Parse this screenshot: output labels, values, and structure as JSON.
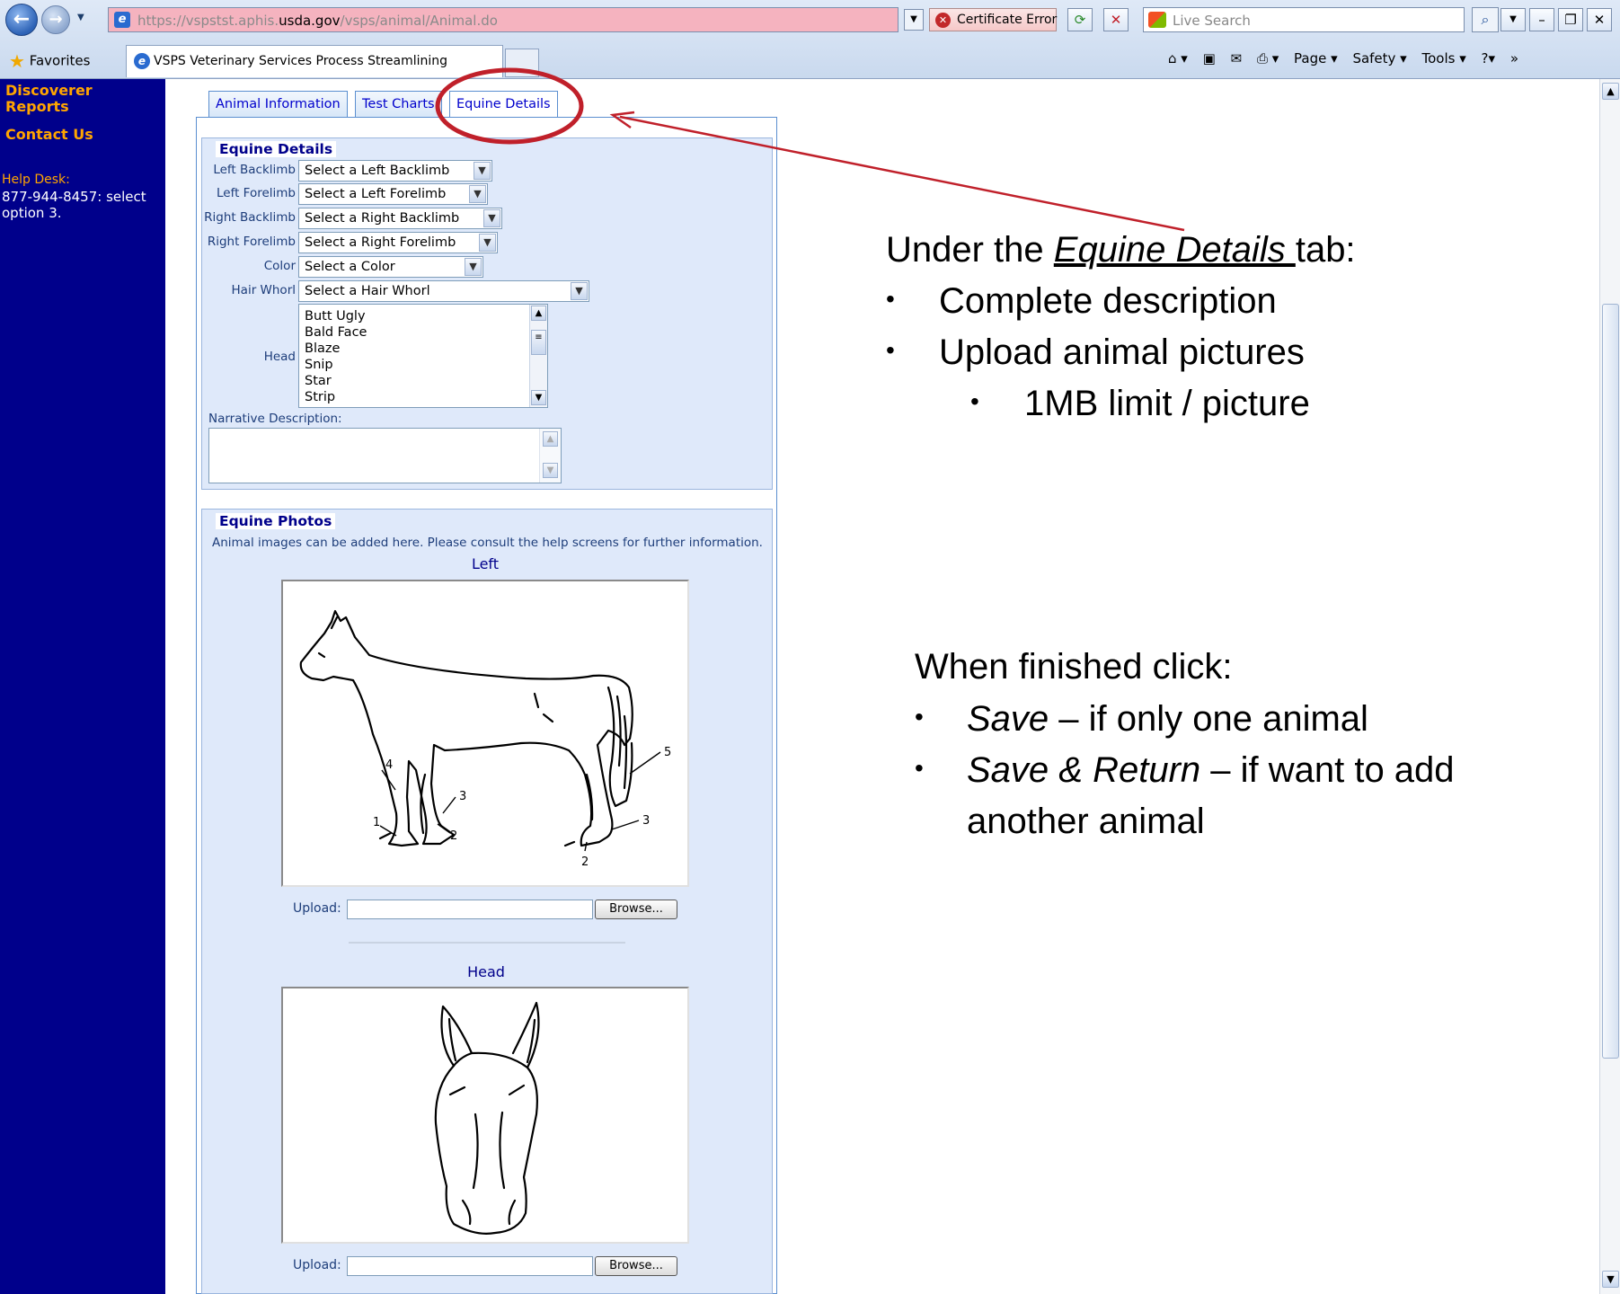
{
  "browser": {
    "url_prefix": "https://vspstst.aphis.",
    "url_domain": "usda.gov",
    "url_suffix": "/vsps/animal/Animal.do",
    "cert_error": "Certificate Error",
    "search_placeholder": "Live Search",
    "favorites": "Favorites",
    "tab_title": "VSPS Veterinary Services Process Streamlining",
    "cmd_page": "Page ▾",
    "cmd_safety": "Safety ▾",
    "cmd_tools": "Tools ▾"
  },
  "sidebar": {
    "discoverer_reports": "Discoverer Reports",
    "contact_us": "Contact Us",
    "help_label": "Help Desk:",
    "help_text": "877-944-8457: select option 3."
  },
  "tabs": [
    "Animal Information",
    "Test Charts",
    "Equine Details"
  ],
  "details": {
    "legend": "Equine Details",
    "fields": [
      {
        "label": "Left Backlimb",
        "value": "Select a Left Backlimb"
      },
      {
        "label": "Left Forelimb",
        "value": "Select a Left Forelimb"
      },
      {
        "label": "Right Backlimb",
        "value": "Select a Right Backlimb"
      },
      {
        "label": "Right Forelimb",
        "value": "Select a Right Forelimb"
      },
      {
        "label": "Color",
        "value": "Select a Color"
      },
      {
        "label": "Hair Whorl",
        "value": "Select a Hair Whorl"
      }
    ],
    "head_label": "Head",
    "head_options": [
      "Butt Ugly",
      "Bald Face",
      "Blaze",
      "Snip",
      "Star",
      "Strip"
    ],
    "narrative_label": "Narrative Description:",
    "narrative_value": ""
  },
  "photos": {
    "legend": "Equine Photos",
    "note": "Animal images can be added here. Please consult the help screens for further information.",
    "sections": [
      {
        "title": "Left",
        "upload_label": "Upload:",
        "browse_label": "Browse..."
      },
      {
        "title": "Head",
        "upload_label": "Upload:",
        "browse_label": "Browse..."
      }
    ],
    "diagram_labels": [
      "4",
      "1",
      "3",
      "2",
      "5",
      "3",
      "2"
    ]
  },
  "annotation": {
    "tab_intro": "Under the ",
    "tab_name": "Equine Details ",
    "tab_outro": "tab:",
    "bullets": [
      "Complete description",
      "Upload animal pictures"
    ],
    "sub_bullet": "1MB limit / picture",
    "finish": "When finished click:",
    "save": "Save",
    "save_desc": " – if only one animal",
    "save_return": "Save & Return",
    "save_return_desc": " – if want to add",
    "save_return_desc2": "another animal",
    "bullet_char": "•",
    "highlight_color": "#c0202a"
  }
}
